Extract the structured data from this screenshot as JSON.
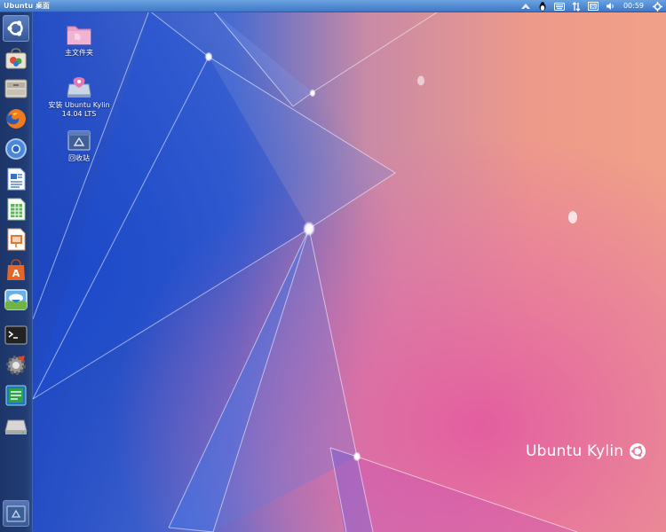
{
  "panel": {
    "title": "Ubuntu 桌面",
    "clock": "00:59",
    "tray_icons": [
      "network-icon",
      "ime-penguin-icon",
      "keyboard-icon",
      "network-transfer-icon",
      "battery-icon",
      "volume-icon",
      "gear-icon"
    ]
  },
  "launcher": {
    "items": [
      {
        "name": "dash-home",
        "icon": "ubuntu-logo-icon"
      },
      {
        "name": "kylin-software-center",
        "icon": "shopping-bag-icon"
      },
      {
        "name": "files",
        "icon": "file-cabinet-icon"
      },
      {
        "name": "firefox",
        "icon": "firefox-icon"
      },
      {
        "name": "chromium",
        "icon": "chromium-icon"
      },
      {
        "name": "libreoffice-writer",
        "icon": "writer-icon"
      },
      {
        "name": "libreoffice-calc",
        "icon": "calc-icon"
      },
      {
        "name": "libreoffice-impress",
        "icon": "impress-icon"
      },
      {
        "name": "ubuntu-software-center",
        "icon": "software-center-icon"
      },
      {
        "name": "kylin-weather",
        "icon": "weather-icon"
      },
      {
        "name": "terminal",
        "icon": "terminal-icon"
      },
      {
        "name": "system-settings",
        "icon": "settings-icon"
      },
      {
        "name": "kylin-tools",
        "icon": "tools-icon"
      },
      {
        "name": "removable-drive",
        "icon": "drive-icon"
      },
      {
        "name": "trash",
        "icon": "trash-icon"
      }
    ]
  },
  "desktop": {
    "icons": [
      {
        "name": "home-folder",
        "label": "主文件夹",
        "icon": "folder-icon"
      },
      {
        "name": "install-ubuntu-kylin",
        "label_line1": "安装 Ubuntu Kylin",
        "label_line2": "14.04 LTS",
        "icon": "installer-icon"
      },
      {
        "name": "trash",
        "label": "回收站",
        "icon": "trash-icon"
      }
    ]
  },
  "branding": {
    "text": "Ubuntu Kylin"
  },
  "colors": {
    "panel": "#4d86d0",
    "launcher": "#213c74",
    "wallpaper_blue": "#2350c8",
    "wallpaper_peach": "#e89a88",
    "wallpaper_pink": "#e060a0"
  }
}
